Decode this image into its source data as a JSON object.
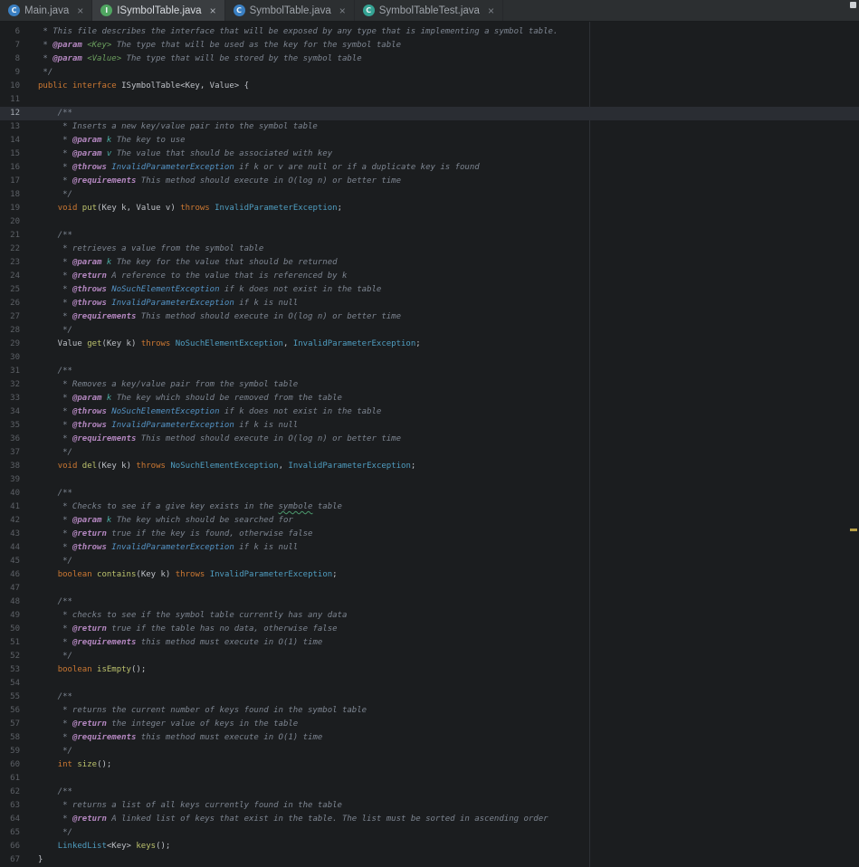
{
  "window": {
    "active_file": "ISymbolTable.java"
  },
  "tab_bar": {
    "close_icon": "×",
    "tabs": [
      {
        "label": "Main.java",
        "icon_letter": "C",
        "icon_color": "#3a7fc2",
        "icon_name": "class-icon",
        "active": false
      },
      {
        "label": "ISymbolTable.java",
        "icon_letter": "I",
        "icon_color": "#50a661",
        "icon_name": "interface-icon",
        "active": true
      },
      {
        "label": "SymbolTable.java",
        "icon_letter": "C",
        "icon_color": "#3a7fc2",
        "icon_name": "class-icon",
        "active": false
      },
      {
        "label": "SymbolTableTest.java",
        "icon_letter": "C",
        "icon_color": "#35a394",
        "icon_name": "test-class-icon",
        "active": false
      }
    ]
  },
  "editor": {
    "language": "java",
    "current_line": 12,
    "lines": [
      {
        "n": 6,
        "tk": [
          [
            "c",
            " * This file describes the interface that will be exposed by any type that is implementing a symbol table."
          ]
        ]
      },
      {
        "n": 7,
        "tk": [
          [
            "c",
            " * "
          ],
          [
            "t",
            "@param"
          ],
          [
            "c",
            " "
          ],
          [
            "g",
            "<Key>"
          ],
          [
            "c",
            " The type that will be used as the key for the symbol table"
          ]
        ]
      },
      {
        "n": 8,
        "tk": [
          [
            "c",
            " * "
          ],
          [
            "t",
            "@param"
          ],
          [
            "c",
            " "
          ],
          [
            "g",
            "<Value>"
          ],
          [
            "c",
            " The type that will be stored by the symbol table"
          ]
        ]
      },
      {
        "n": 9,
        "tk": [
          [
            "c",
            " */"
          ]
        ]
      },
      {
        "n": 10,
        "tk": [
          [
            "k",
            "public"
          ],
          [
            "d",
            " "
          ],
          [
            "k",
            "interface"
          ],
          [
            "d",
            " ISymbolTable<Key, Value> {"
          ]
        ]
      },
      {
        "n": 11,
        "tk": []
      },
      {
        "n": 12,
        "tk": [
          [
            "c",
            "    /**"
          ]
        ]
      },
      {
        "n": 13,
        "tk": [
          [
            "c",
            "     * Inserts a new key/value pair into the symbol table"
          ]
        ]
      },
      {
        "n": 14,
        "tk": [
          [
            "c",
            "     * "
          ],
          [
            "t",
            "@param"
          ],
          [
            "c",
            " "
          ],
          [
            "v",
            "k"
          ],
          [
            "c",
            " The key to use"
          ]
        ]
      },
      {
        "n": 15,
        "tk": [
          [
            "c",
            "     * "
          ],
          [
            "t",
            "@param"
          ],
          [
            "c",
            " "
          ],
          [
            "v",
            "v"
          ],
          [
            "c",
            " The value that should be associated with key"
          ]
        ]
      },
      {
        "n": 16,
        "tk": [
          [
            "c",
            "     * "
          ],
          [
            "t",
            "@throws"
          ],
          [
            "c",
            " "
          ],
          [
            "x",
            "InvalidParameterException"
          ],
          [
            "c",
            " if k or v are null or if a duplicate key is found"
          ]
        ]
      },
      {
        "n": 17,
        "tk": [
          [
            "c",
            "     * "
          ],
          [
            "t",
            "@requirements"
          ],
          [
            "c",
            " This method should execute in O(log n) or better time"
          ]
        ]
      },
      {
        "n": 18,
        "tk": [
          [
            "c",
            "     */"
          ]
        ]
      },
      {
        "n": 19,
        "tk": [
          [
            "d",
            "    "
          ],
          [
            "k",
            "void"
          ],
          [
            "d",
            " "
          ],
          [
            "m",
            "put"
          ],
          [
            "d",
            "(Key k, Value v) "
          ],
          [
            "k",
            "throws"
          ],
          [
            "d",
            " "
          ],
          [
            "cl",
            "InvalidParameterException"
          ],
          [
            "d",
            ";"
          ]
        ]
      },
      {
        "n": 20,
        "tk": []
      },
      {
        "n": 21,
        "tk": [
          [
            "c",
            "    /**"
          ]
        ]
      },
      {
        "n": 22,
        "tk": [
          [
            "c",
            "     * retrieves a value from the symbol table"
          ]
        ]
      },
      {
        "n": 23,
        "tk": [
          [
            "c",
            "     * "
          ],
          [
            "t",
            "@param"
          ],
          [
            "c",
            " "
          ],
          [
            "v",
            "k"
          ],
          [
            "c",
            " The key for the value that should be returned"
          ]
        ]
      },
      {
        "n": 24,
        "tk": [
          [
            "c",
            "     * "
          ],
          [
            "t",
            "@return"
          ],
          [
            "c",
            " A reference to the value that is referenced by k"
          ]
        ]
      },
      {
        "n": 25,
        "tk": [
          [
            "c",
            "     * "
          ],
          [
            "t",
            "@throws"
          ],
          [
            "c",
            " "
          ],
          [
            "x",
            "NoSuchElementException"
          ],
          [
            "c",
            " if k does not exist in the table"
          ]
        ]
      },
      {
        "n": 26,
        "tk": [
          [
            "c",
            "     * "
          ],
          [
            "t",
            "@throws"
          ],
          [
            "c",
            " "
          ],
          [
            "x",
            "InvalidParameterException"
          ],
          [
            "c",
            " if k is null"
          ]
        ]
      },
      {
        "n": 27,
        "tk": [
          [
            "c",
            "     * "
          ],
          [
            "t",
            "@requirements"
          ],
          [
            "c",
            " This method should execute in O(log n) or better time"
          ]
        ]
      },
      {
        "n": 28,
        "tk": [
          [
            "c",
            "     */"
          ]
        ]
      },
      {
        "n": 29,
        "tk": [
          [
            "d",
            "    Value "
          ],
          [
            "m",
            "get"
          ],
          [
            "d",
            "(Key k) "
          ],
          [
            "k",
            "throws"
          ],
          [
            "d",
            " "
          ],
          [
            "cl",
            "NoSuchElementException"
          ],
          [
            "d",
            ", "
          ],
          [
            "cl",
            "InvalidParameterException"
          ],
          [
            "d",
            ";"
          ]
        ]
      },
      {
        "n": 30,
        "tk": []
      },
      {
        "n": 31,
        "tk": [
          [
            "c",
            "    /**"
          ]
        ]
      },
      {
        "n": 32,
        "tk": [
          [
            "c",
            "     * Removes a key/value pair from the symbol table"
          ]
        ]
      },
      {
        "n": 33,
        "tk": [
          [
            "c",
            "     * "
          ],
          [
            "t",
            "@param"
          ],
          [
            "c",
            " "
          ],
          [
            "v",
            "k"
          ],
          [
            "c",
            " The key which should be removed from the table"
          ]
        ]
      },
      {
        "n": 34,
        "tk": [
          [
            "c",
            "     * "
          ],
          [
            "t",
            "@throws"
          ],
          [
            "c",
            " "
          ],
          [
            "x",
            "NoSuchElementException"
          ],
          [
            "c",
            " if k does not exist in the table"
          ]
        ]
      },
      {
        "n": 35,
        "tk": [
          [
            "c",
            "     * "
          ],
          [
            "t",
            "@throws"
          ],
          [
            "c",
            " "
          ],
          [
            "x",
            "InvalidParameterException"
          ],
          [
            "c",
            " if k is null"
          ]
        ]
      },
      {
        "n": 36,
        "tk": [
          [
            "c",
            "     * "
          ],
          [
            "t",
            "@requirements"
          ],
          [
            "c",
            " This method should execute in O(log n) or better time"
          ]
        ]
      },
      {
        "n": 37,
        "tk": [
          [
            "c",
            "     */"
          ]
        ]
      },
      {
        "n": 38,
        "tk": [
          [
            "d",
            "    "
          ],
          [
            "k",
            "void"
          ],
          [
            "d",
            " "
          ],
          [
            "m",
            "del"
          ],
          [
            "d",
            "(Key k) "
          ],
          [
            "k",
            "throws"
          ],
          [
            "d",
            " "
          ],
          [
            "cl",
            "NoSuchElementException"
          ],
          [
            "d",
            ", "
          ],
          [
            "cl",
            "InvalidParameterException"
          ],
          [
            "d",
            ";"
          ]
        ]
      },
      {
        "n": 39,
        "tk": []
      },
      {
        "n": 40,
        "tk": [
          [
            "c",
            "    /**"
          ]
        ]
      },
      {
        "n": 41,
        "tk": [
          [
            "c",
            "     * Checks to see if a give key exists in the "
          ],
          [
            "typo",
            "symbole"
          ],
          [
            "c",
            " table"
          ]
        ]
      },
      {
        "n": 42,
        "tk": [
          [
            "c",
            "     * "
          ],
          [
            "t",
            "@param"
          ],
          [
            "c",
            " "
          ],
          [
            "v",
            "k"
          ],
          [
            "c",
            " The key which should be searched for"
          ]
        ]
      },
      {
        "n": 43,
        "tk": [
          [
            "c",
            "     * "
          ],
          [
            "t",
            "@return"
          ],
          [
            "c",
            " true if the key is found, otherwise false"
          ]
        ]
      },
      {
        "n": 44,
        "tk": [
          [
            "c",
            "     * "
          ],
          [
            "t",
            "@throws"
          ],
          [
            "c",
            " "
          ],
          [
            "x",
            "InvalidParameterException"
          ],
          [
            "c",
            " if k is null"
          ]
        ]
      },
      {
        "n": 45,
        "tk": [
          [
            "c",
            "     */"
          ]
        ]
      },
      {
        "n": 46,
        "tk": [
          [
            "d",
            "    "
          ],
          [
            "k",
            "boolean"
          ],
          [
            "d",
            " "
          ],
          [
            "m",
            "contains"
          ],
          [
            "d",
            "(Key k) "
          ],
          [
            "k",
            "throws"
          ],
          [
            "d",
            " "
          ],
          [
            "cl",
            "InvalidParameterException"
          ],
          [
            "d",
            ";"
          ]
        ]
      },
      {
        "n": 47,
        "tk": []
      },
      {
        "n": 48,
        "tk": [
          [
            "c",
            "    /**"
          ]
        ]
      },
      {
        "n": 49,
        "tk": [
          [
            "c",
            "     * checks to see if the symbol table currently has any data"
          ]
        ]
      },
      {
        "n": 50,
        "tk": [
          [
            "c",
            "     * "
          ],
          [
            "t",
            "@return"
          ],
          [
            "c",
            " true if the table has no data, otherwise false"
          ]
        ]
      },
      {
        "n": 51,
        "tk": [
          [
            "c",
            "     * "
          ],
          [
            "t",
            "@requirements"
          ],
          [
            "c",
            " this method must execute in O(1) time"
          ]
        ]
      },
      {
        "n": 52,
        "tk": [
          [
            "c",
            "     */"
          ]
        ]
      },
      {
        "n": 53,
        "tk": [
          [
            "d",
            "    "
          ],
          [
            "k",
            "boolean"
          ],
          [
            "d",
            " "
          ],
          [
            "m",
            "isEmpty"
          ],
          [
            "d",
            "();"
          ]
        ]
      },
      {
        "n": 54,
        "tk": []
      },
      {
        "n": 55,
        "tk": [
          [
            "c",
            "    /**"
          ]
        ]
      },
      {
        "n": 56,
        "tk": [
          [
            "c",
            "     * returns the current number of keys found in the symbol table"
          ]
        ]
      },
      {
        "n": 57,
        "tk": [
          [
            "c",
            "     * "
          ],
          [
            "t",
            "@return"
          ],
          [
            "c",
            " the integer value of keys in the table"
          ]
        ]
      },
      {
        "n": 58,
        "tk": [
          [
            "c",
            "     * "
          ],
          [
            "t",
            "@requirements"
          ],
          [
            "c",
            " this method must execute in O(1) time"
          ]
        ]
      },
      {
        "n": 59,
        "tk": [
          [
            "c",
            "     */"
          ]
        ]
      },
      {
        "n": 60,
        "tk": [
          [
            "d",
            "    "
          ],
          [
            "k",
            "int"
          ],
          [
            "d",
            " "
          ],
          [
            "m",
            "size"
          ],
          [
            "d",
            "();"
          ]
        ]
      },
      {
        "n": 61,
        "tk": []
      },
      {
        "n": 62,
        "tk": [
          [
            "c",
            "    /**"
          ]
        ]
      },
      {
        "n": 63,
        "tk": [
          [
            "c",
            "     * returns a list of all keys currently found in the table"
          ]
        ]
      },
      {
        "n": 64,
        "tk": [
          [
            "c",
            "     * "
          ],
          [
            "t",
            "@return"
          ],
          [
            "c",
            " A linked list of keys that exist in the table. The list must be sorted in ascending order"
          ]
        ]
      },
      {
        "n": 65,
        "tk": [
          [
            "c",
            "     */"
          ]
        ]
      },
      {
        "n": 66,
        "tk": [
          [
            "d",
            "    "
          ],
          [
            "cl",
            "LinkedList"
          ],
          [
            "d",
            "<Key> "
          ],
          [
            "m",
            "keys"
          ],
          [
            "d",
            "();"
          ]
        ]
      },
      {
        "n": 67,
        "tk": [
          [
            "d",
            "}"
          ]
        ]
      }
    ]
  },
  "palette": {
    "editor-bg": "#1b1d1f",
    "tabbar-bg": "#2c2f31",
    "tab-active-bg": "#3a3d40",
    "tab-text": "#9fa4ab",
    "tab-active-text": "#d8dbe0",
    "gutter-text": "#5c6066",
    "caret-line": "#2a2d33",
    "comment": "#7d8591",
    "doc-tag": "#b487c0",
    "doc-param": "#4ba8a0",
    "doc-typeparam": "#6b9f5e",
    "doc-classref": "#5493c5",
    "keyword": "#cc7832",
    "method": "#bcc26d",
    "class-ref": "#4f9dc0",
    "default-text": "#bdc0c6",
    "typo-underline": "#4c9a6e",
    "guide-line": "#2e3135",
    "warning-mark": "#d0b44c",
    "indicator": "#cdd0d4"
  }
}
